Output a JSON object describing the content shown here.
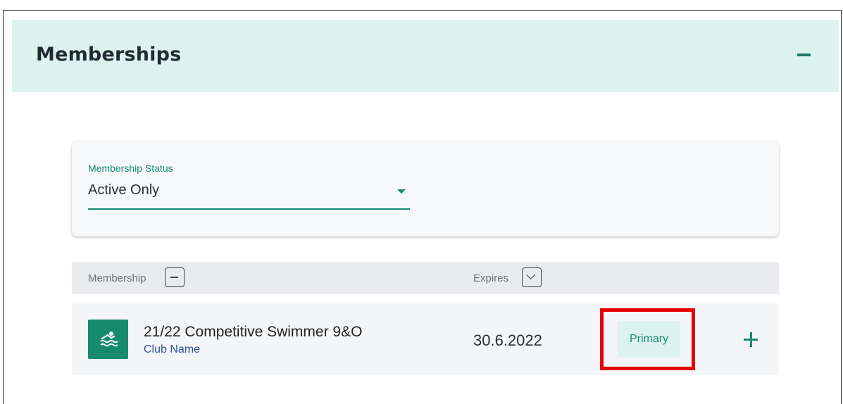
{
  "section": {
    "title": "Memberships"
  },
  "filter": {
    "label": "Membership Status",
    "value": "Active Only"
  },
  "table": {
    "columns": {
      "membership": "Membership",
      "expires": "Expires"
    },
    "rows": [
      {
        "title": "21/22 Competitive Swimmer 9&O",
        "club": "Club Name",
        "expires": "30.6.2022",
        "badge": "Primary",
        "icon": "swimmer-icon"
      }
    ]
  },
  "colors": {
    "accent": "#158a72",
    "header_bg": "#dcf2ee",
    "highlight": "#e60000"
  }
}
